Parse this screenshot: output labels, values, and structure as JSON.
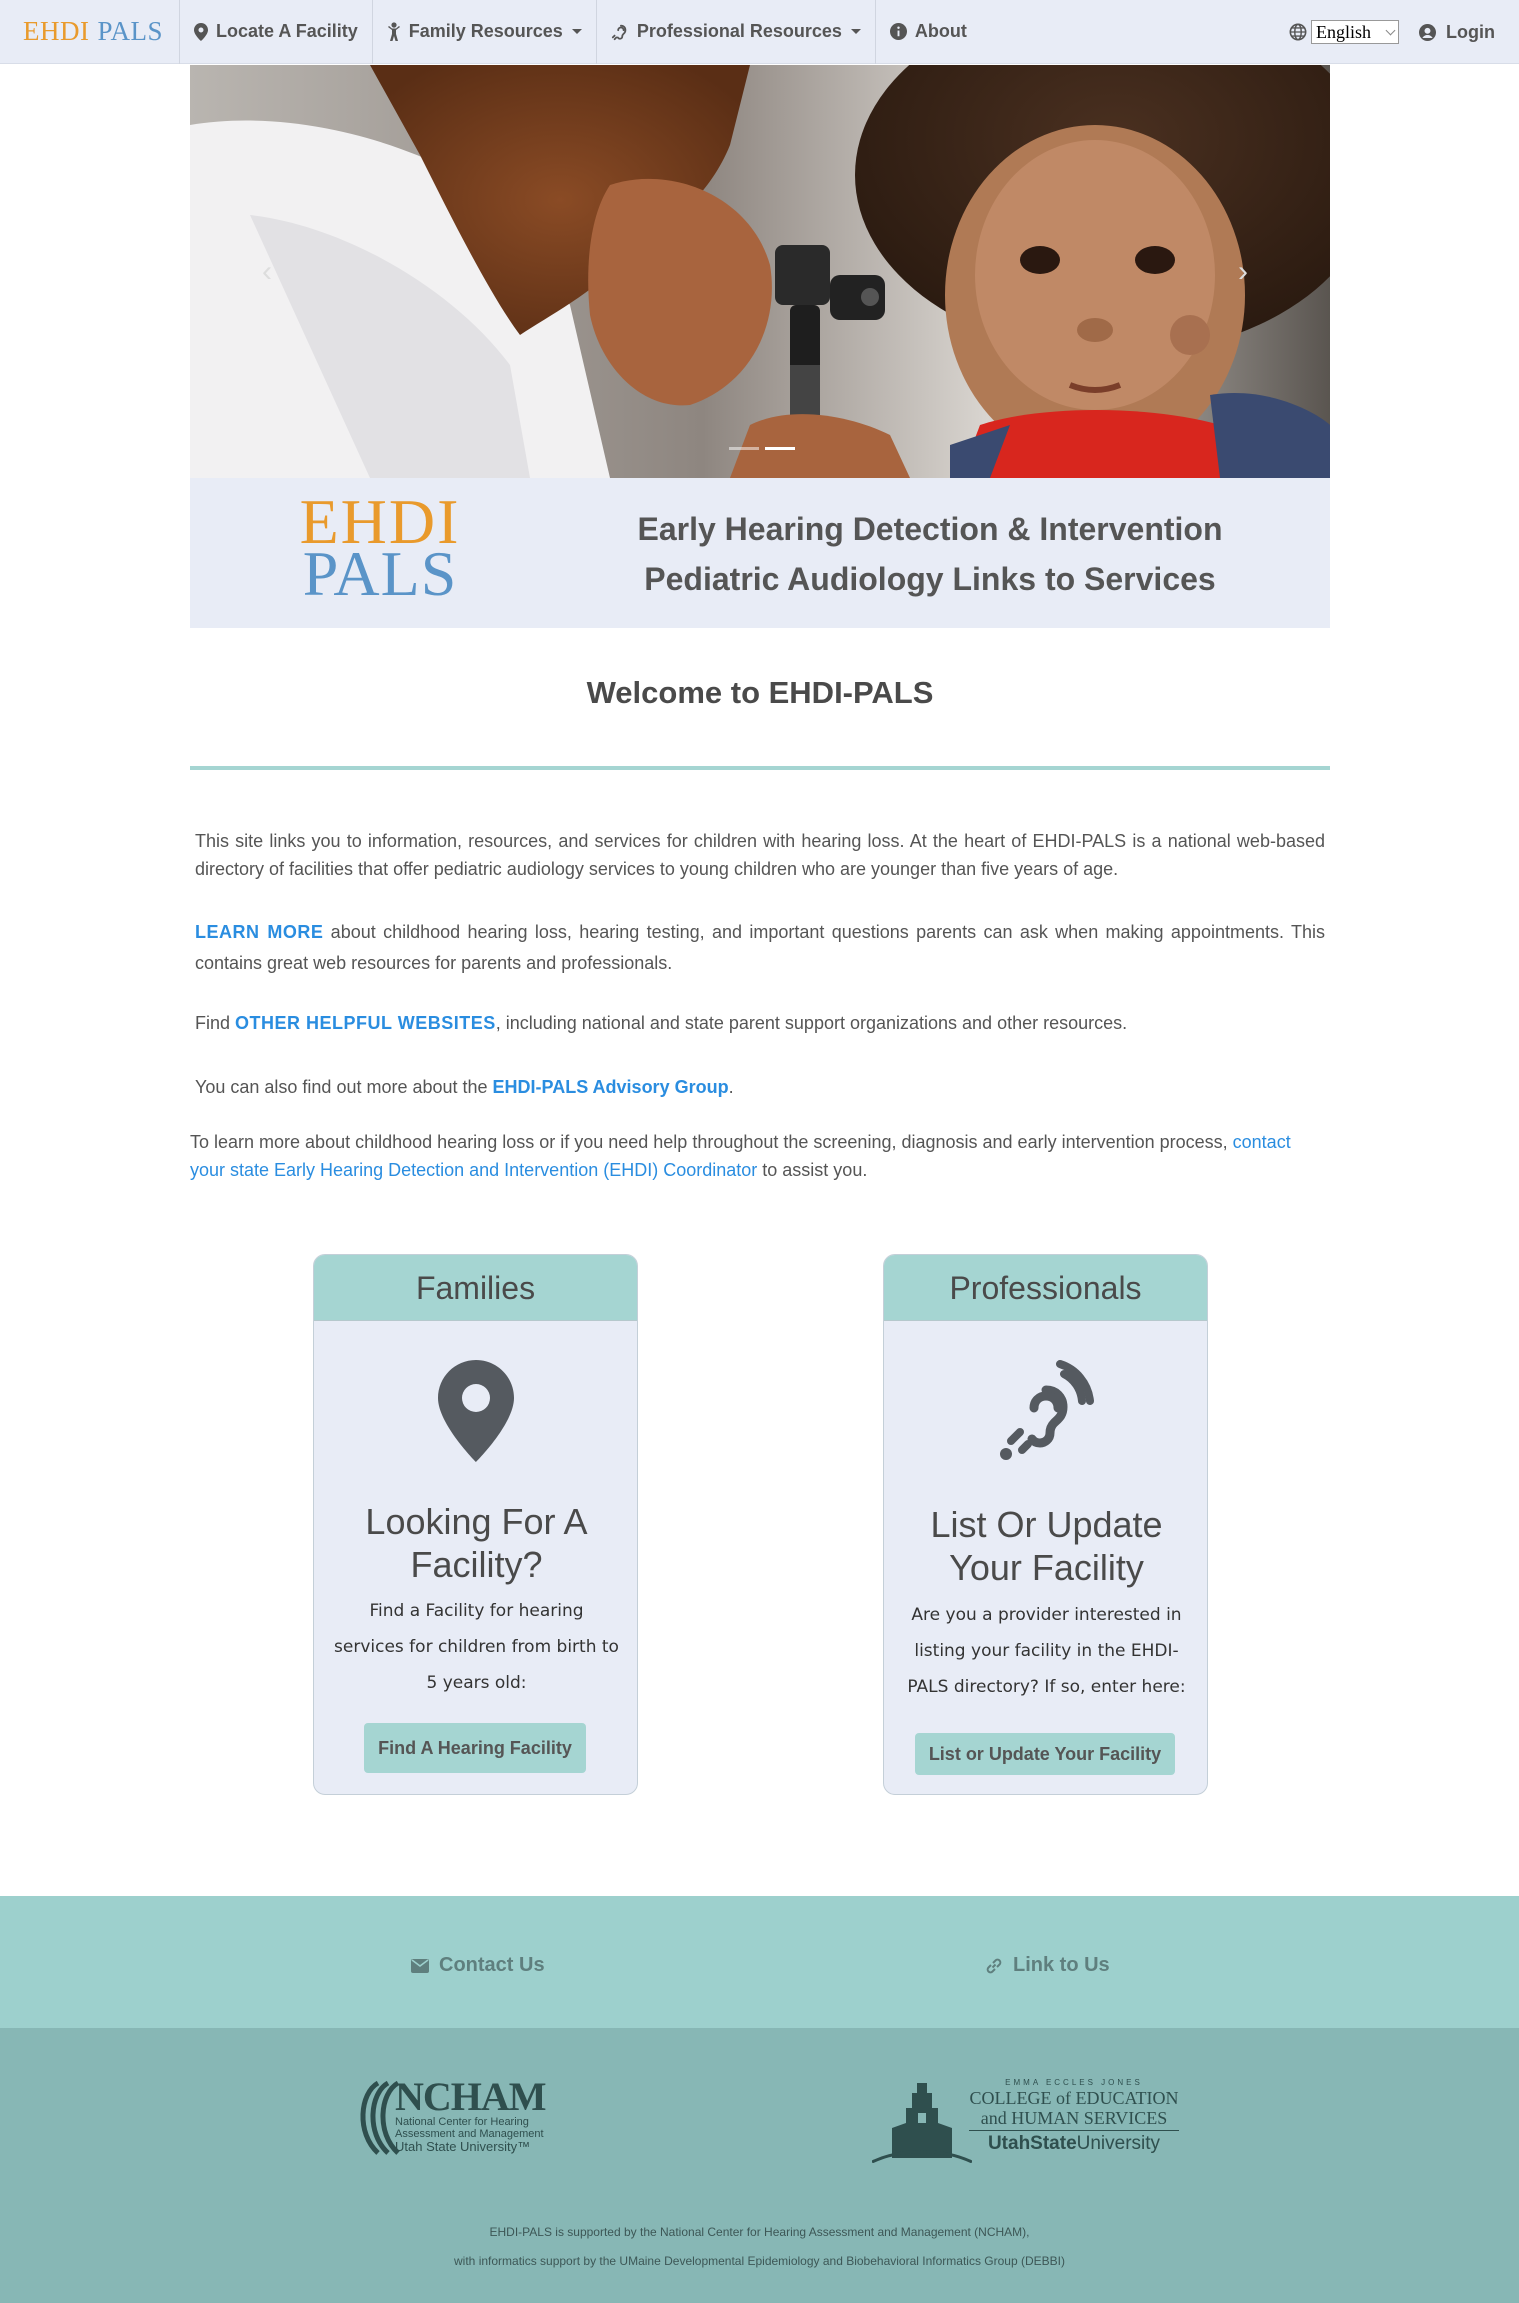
{
  "brand": {
    "part1": "EHDI",
    "part2": "PALS"
  },
  "nav": {
    "locate": "Locate A Facility",
    "family": "Family Resources",
    "professional": "Professional Resources",
    "about": "About",
    "language": "English",
    "login": "Login"
  },
  "banner": {
    "logo1": "EHDI",
    "logo2": "PALS",
    "line1": "Early Hearing Detection & Intervention",
    "line2": "Pediatric Audiology Links to Services"
  },
  "welcome": "Welcome to EHDI-PALS",
  "intro": "This site links you to information, resources, and services for children with hearing loss. At the heart of EHDI-PALS is a national web-based directory of facilities that offer pediatric audiology services to young children who are younger than five years of age.",
  "learn": {
    "link": "LEARN MORE",
    "text": " about childhood hearing loss, hearing testing, and important questions parents can ask when making appointments. This contains great web resources for parents and professionals."
  },
  "other": {
    "pre": "Find ",
    "link": "OTHER HELPFUL WEBSITES",
    "post": ", including national and state parent support organizations and other resources."
  },
  "advisory": {
    "pre": "You can also find out more about the ",
    "link": "EHDI-PALS Advisory Group",
    "post": "."
  },
  "contact": {
    "pre": "To learn more about childhood hearing loss or if you need help throughout the screening, diagnosis and early intervention process, ",
    "link": "contact your state Early Hearing Detection and Intervention (EHDI) Coordinator",
    "post": " to assist you."
  },
  "families": {
    "header": "Families",
    "title": "Looking For A Facility?",
    "text": "Find a Facility for hearing services for children from birth to 5 years old:",
    "button": "Find A Hearing Facility"
  },
  "professionals": {
    "header": "Professionals",
    "title": "List Or Update Your Facility",
    "text": "Are you a provider interested in listing your facility in the EHDI-PALS directory? If so, enter here:",
    "button": "List or Update Your Facility"
  },
  "footer": {
    "contact": "Contact Us",
    "link": "Link to Us",
    "ncham": {
      "name": "NCHAM",
      "line1": "National Center for Hearing",
      "line2": "Assessment and Management",
      "line3": "Utah State University™"
    },
    "college": {
      "top": "EMMA ECCLES JONES",
      "line1": "COLLEGE of EDUCATION",
      "line2": "and HUMAN SERVICES",
      "usu1": "UtahState",
      "usu2": "University"
    },
    "support1": "EHDI-PALS is supported by the National Center for Hearing Assessment and Management (NCHAM),",
    "support2": "with informatics support by the UMaine Developmental Epidemiology and Biobehavioral Informatics Group (DEBBI)"
  },
  "colors": {
    "accent": "#a5d5d2",
    "link": "#2a8de0",
    "nav_bg": "#e8ecf6",
    "footer_top": "#9dd0cd",
    "footer_bottom": "#87b7b5",
    "orange": "#e99a2c",
    "blue": "#5a94c8"
  }
}
